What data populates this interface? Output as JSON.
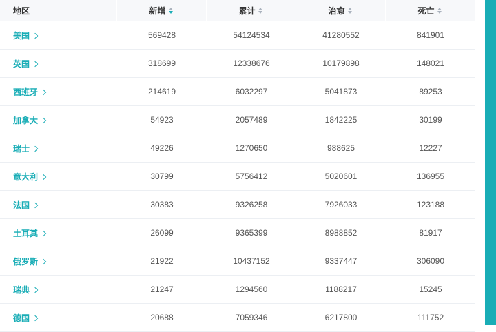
{
  "header": {
    "region": "地区",
    "new": "新增",
    "total": "累计",
    "recovered": "治愈",
    "deaths": "死亡"
  },
  "rows": [
    {
      "region": "美国",
      "new": "569428",
      "total": "54124534",
      "recovered": "41280552",
      "deaths": "841901"
    },
    {
      "region": "英国",
      "new": "318699",
      "total": "12338676",
      "recovered": "10179898",
      "deaths": "148021"
    },
    {
      "region": "西班牙",
      "new": "214619",
      "total": "6032297",
      "recovered": "5041873",
      "deaths": "89253"
    },
    {
      "region": "加拿大",
      "new": "54923",
      "total": "2057489",
      "recovered": "1842225",
      "deaths": "30199"
    },
    {
      "region": "瑞士",
      "new": "49226",
      "total": "1270650",
      "recovered": "988625",
      "deaths": "12227"
    },
    {
      "region": "意大利",
      "new": "30799",
      "total": "5756412",
      "recovered": "5020601",
      "deaths": "136955"
    },
    {
      "region": "法国",
      "new": "30383",
      "total": "9326258",
      "recovered": "7926033",
      "deaths": "123188"
    },
    {
      "region": "土耳其",
      "new": "26099",
      "total": "9365399",
      "recovered": "8988852",
      "deaths": "81917"
    },
    {
      "region": "俄罗斯",
      "new": "21922",
      "total": "10437152",
      "recovered": "9337447",
      "deaths": "306090"
    },
    {
      "region": "瑞典",
      "new": "21247",
      "total": "1294560",
      "recovered": "1188217",
      "deaths": "15245"
    },
    {
      "region": "德国",
      "new": "20688",
      "total": "7059346",
      "recovered": "6217800",
      "deaths": "111752"
    }
  ],
  "colors": {
    "accent": "#19adb6",
    "header_bg": "#f7f8fa"
  }
}
